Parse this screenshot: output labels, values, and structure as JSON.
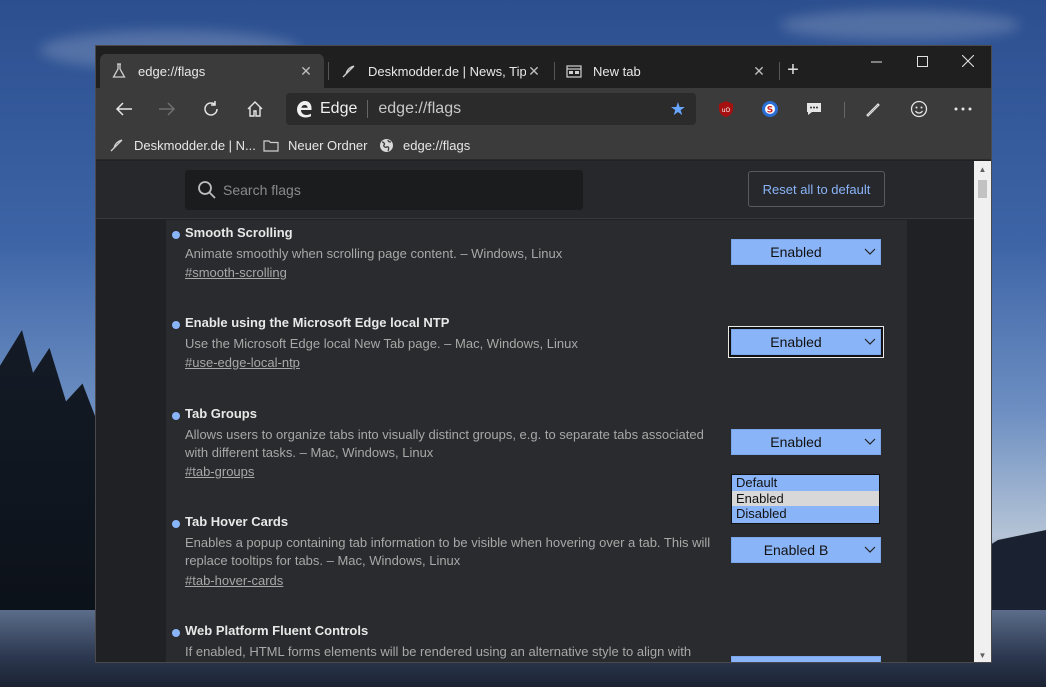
{
  "tabs": [
    {
      "title": "edge://flags",
      "icon": "flask-icon",
      "active": true
    },
    {
      "title": "Deskmodder.de | News, Tipps",
      "icon": "feather-icon",
      "active": false
    },
    {
      "title": "New tab",
      "icon": "newtab-icon",
      "active": false
    }
  ],
  "toolbar": {
    "brand": "Edge",
    "url": "edge://flags"
  },
  "bookmarks": [
    {
      "label": "Deskmodder.de | N...",
      "icon": "feather-icon"
    },
    {
      "label": "Neuer Ordner",
      "icon": "folder-icon"
    },
    {
      "label": "edge://flags",
      "icon": "globe-icon"
    }
  ],
  "search": {
    "placeholder": "Search flags"
  },
  "reset_label": "Reset all to default",
  "flags": [
    {
      "title": "Smooth Scrolling",
      "desc": "Animate smoothly when scrolling page content. – Windows, Linux",
      "link": "#smooth-scrolling",
      "value": "Enabled"
    },
    {
      "title": "Enable using the Microsoft Edge local NTP",
      "desc": "Use the Microsoft Edge local New Tab page. – Mac, Windows, Linux",
      "link": "#use-edge-local-ntp",
      "value": "Enabled"
    },
    {
      "title": "Tab Groups",
      "desc": "Allows users to organize tabs into visually distinct groups, e.g. to separate tabs associated with different tasks. – Mac, Windows, Linux",
      "link": "#tab-groups",
      "value": "Enabled"
    },
    {
      "title": "Tab Hover Cards",
      "desc": "Enables a popup containing tab information to be visible when hovering over a tab. This will replace tooltips for tabs. – Mac, Windows, Linux",
      "link": "#tab-hover-cards",
      "value": "Enabled B"
    },
    {
      "title": "Web Platform Fluent Controls",
      "desc": "If enabled, HTML forms elements will be rendered using an alternative style to align with",
      "link": "",
      "value": ""
    }
  ],
  "dropdown_options": [
    "Default",
    "Enabled",
    "Disabled"
  ],
  "colors": {
    "accent": "#8ab4f8",
    "bg": "#202124"
  }
}
